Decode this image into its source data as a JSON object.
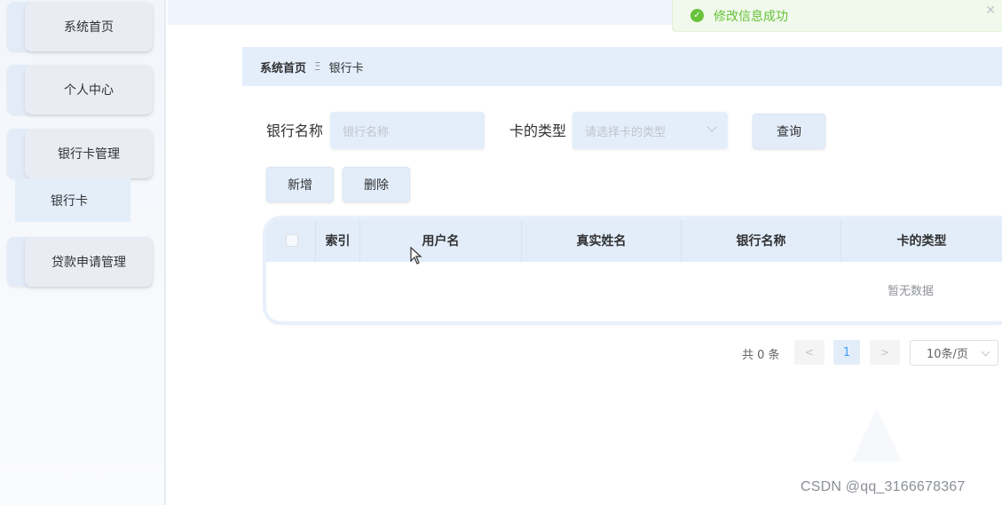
{
  "sidebar": {
    "items": [
      {
        "label": "系统首页"
      },
      {
        "label": "个人中心"
      },
      {
        "label": "银行卡管理",
        "children": [
          {
            "label": "银行卡"
          }
        ]
      },
      {
        "label": "贷款申请管理"
      }
    ]
  },
  "toast": {
    "message": "修改信息成功",
    "icon": "check-circle-icon",
    "color": "#67c23a"
  },
  "breadcrumb": {
    "home": "系统首页",
    "separator": "Ξ",
    "current": "银行卡"
  },
  "search": {
    "bank_name_label": "银行名称",
    "bank_name_placeholder": "银行名称",
    "card_type_label": "卡的类型",
    "card_type_placeholder": "请选择卡的类型",
    "query_button": "查询"
  },
  "actions": {
    "add_button": "新增",
    "delete_button": "删除"
  },
  "table": {
    "columns": [
      "索引",
      "用户名",
      "真实姓名",
      "银行名称",
      "卡的类型"
    ],
    "rows": [],
    "empty_text": "暂无数据"
  },
  "pagination": {
    "total": "共 0 条",
    "prev": "<",
    "current_page": "1",
    "next": ">",
    "page_size": "10条/页"
  },
  "watermark": "CSDN @qq_3166678367",
  "colors": {
    "accent": "#409eff",
    "panel": "#e3edfa",
    "success": "#67c23a"
  }
}
